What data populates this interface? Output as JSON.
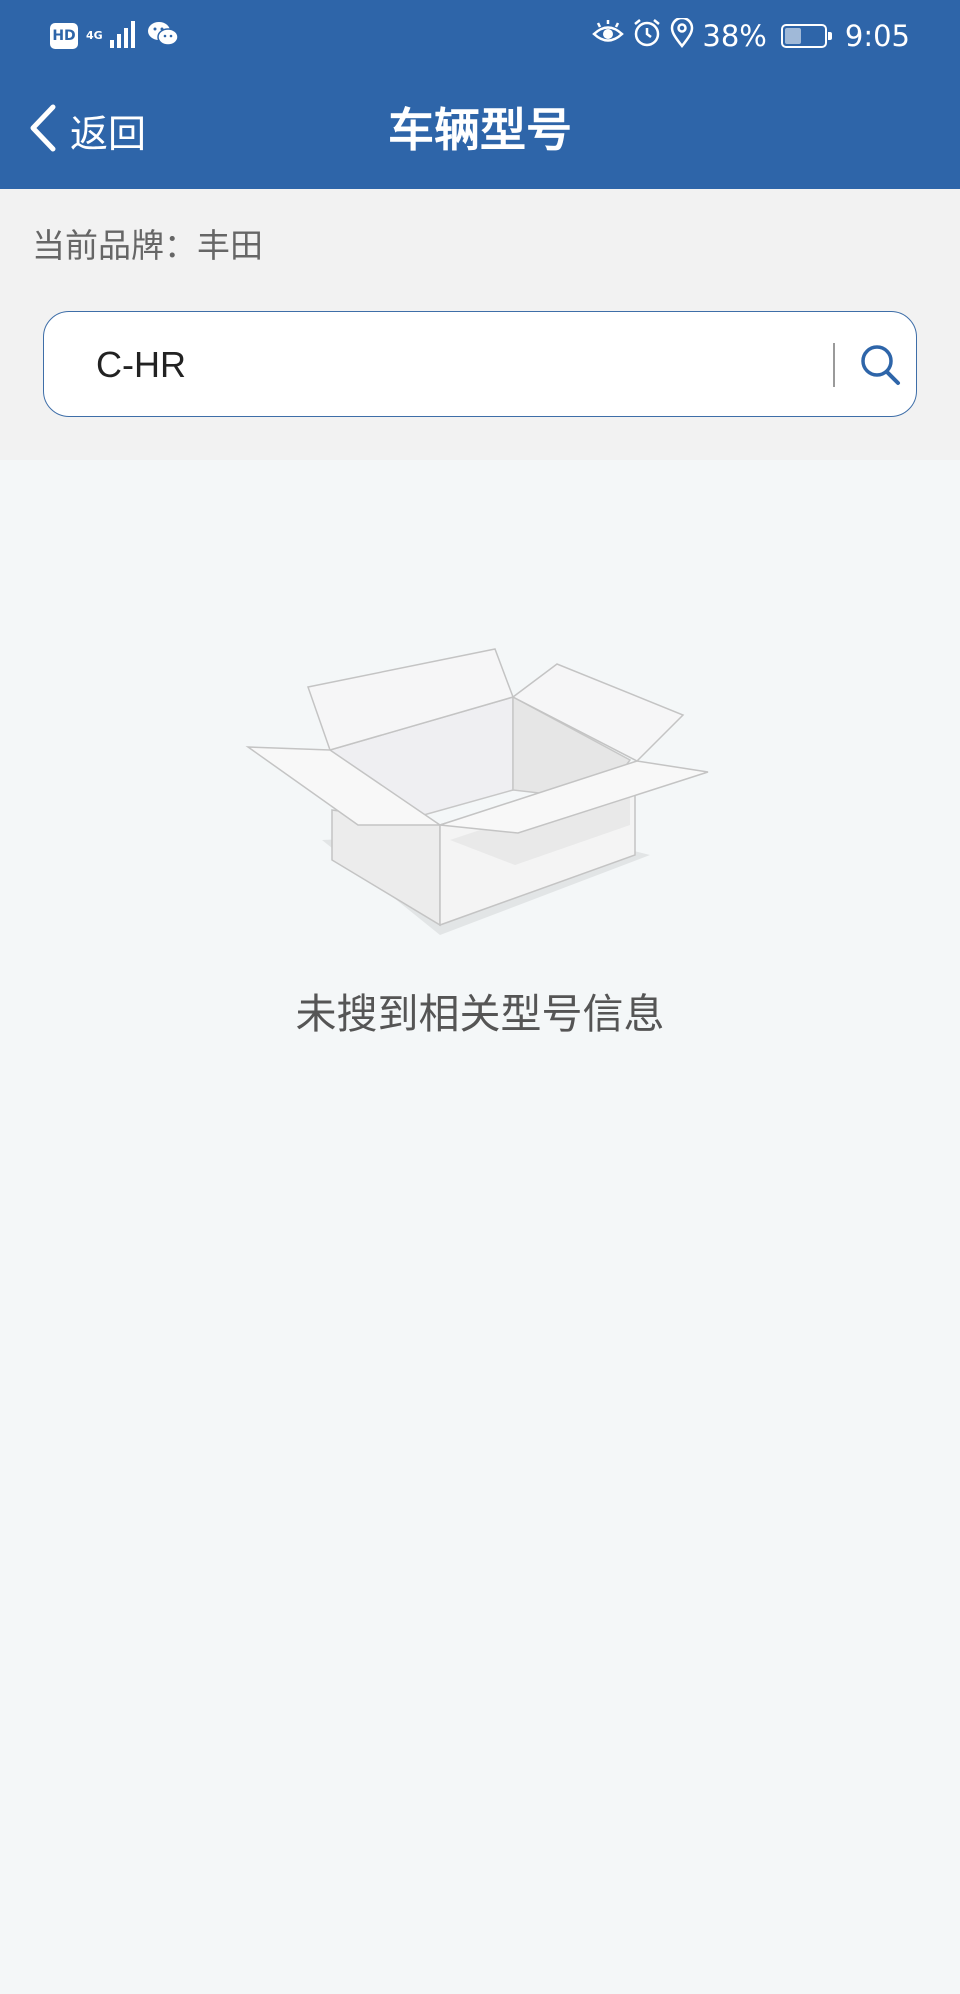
{
  "status_bar": {
    "hd_label": "HD",
    "network": "4G",
    "battery": "38%",
    "battery_level": 0.38,
    "time": "9:05",
    "icons": [
      "signal-icon",
      "wechat-icon",
      "eye-care-icon",
      "alarm-icon",
      "location-icon",
      "battery-icon"
    ]
  },
  "nav": {
    "back_label": "返回",
    "title": "车辆型号"
  },
  "brand": {
    "label": "当前品牌：",
    "value": "丰田"
  },
  "search": {
    "value": "C-HR",
    "placeholder": ""
  },
  "empty": {
    "message": "未搜到相关型号信息"
  },
  "colors": {
    "header": "#2e65a9",
    "panel": "#f2f2f2",
    "background": "#f4f7f8",
    "accent": "#3e6ea8"
  }
}
